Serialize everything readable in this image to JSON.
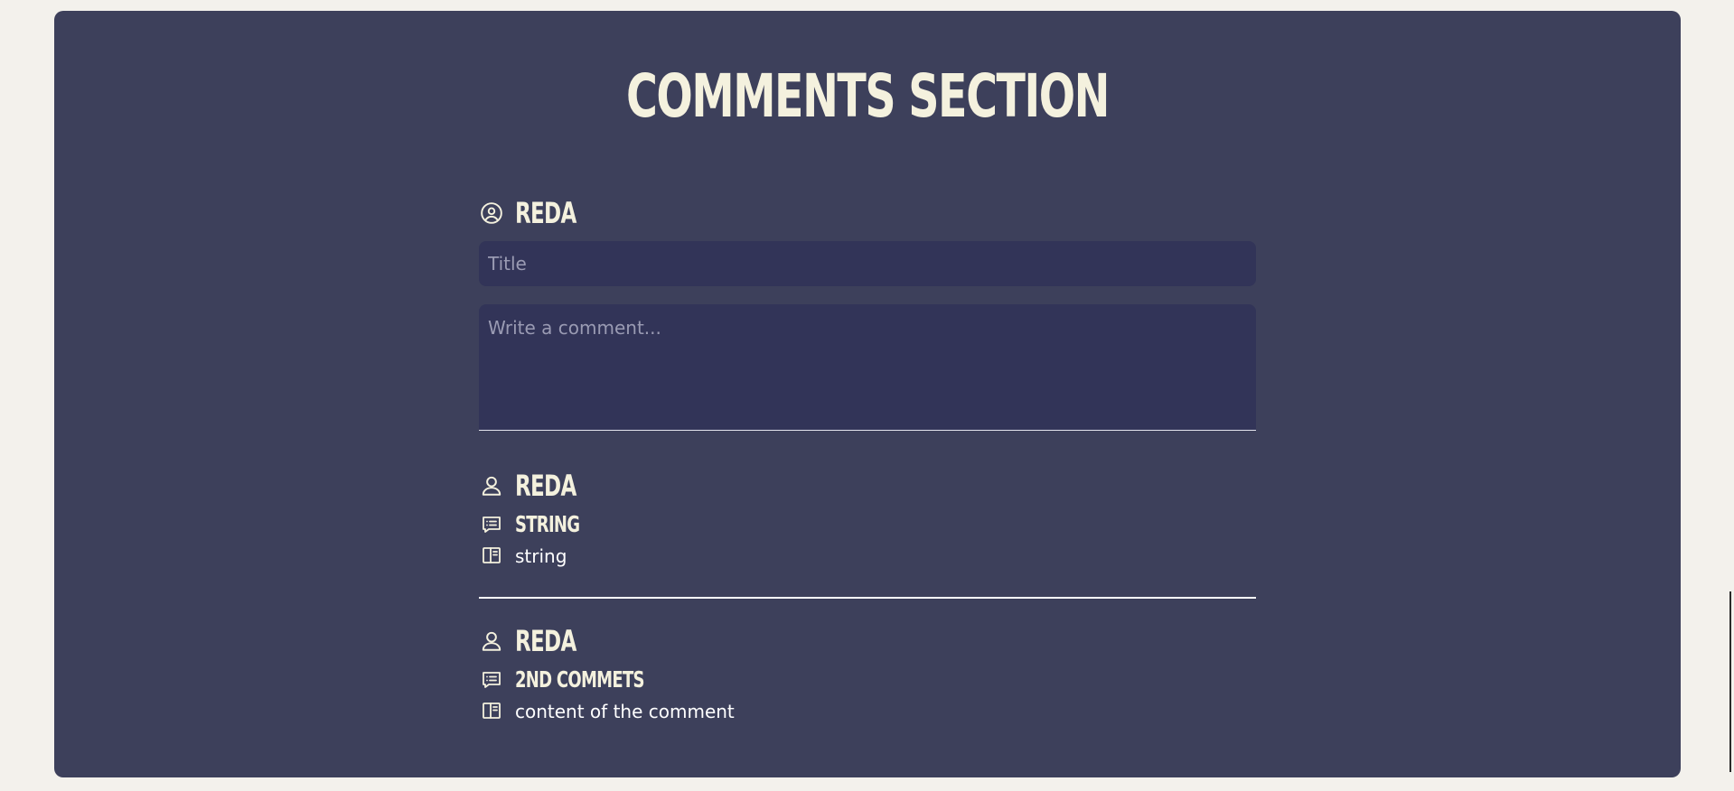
{
  "page": {
    "title": "COMMENTS SECTION"
  },
  "composer": {
    "user_name": "REDA",
    "title_placeholder": "Title",
    "comment_placeholder": "Write a comment..."
  },
  "comments": [
    {
      "author": "REDA",
      "title": "STRING",
      "content": "string"
    },
    {
      "author": "REDA",
      "title": "2ND COMMETS",
      "content": "content of the comment"
    }
  ],
  "colors": {
    "background": "#f3f1ec",
    "card": "#3d405b",
    "input": "#323458",
    "text": "#f4f1de"
  },
  "icons": {
    "composer_user": "user-circle-icon",
    "comment_author": "user-icon",
    "comment_title": "message-square-text-icon",
    "comment_content": "book-open-icon"
  }
}
